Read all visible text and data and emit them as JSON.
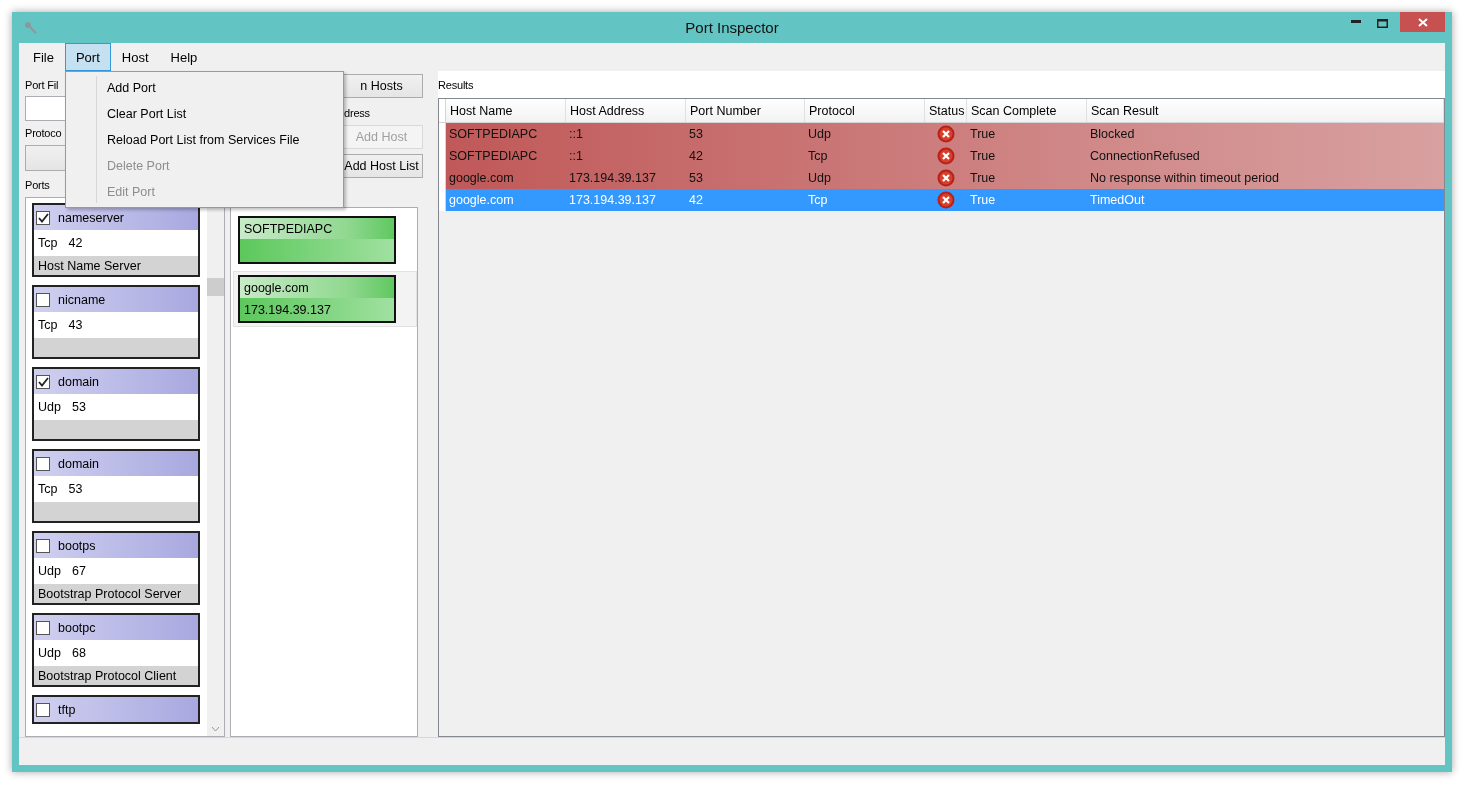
{
  "window": {
    "title": "Port Inspector"
  },
  "menu_bar": [
    {
      "label": "File",
      "selected": false
    },
    {
      "label": "Port",
      "selected": true
    },
    {
      "label": "Host",
      "selected": false
    },
    {
      "label": "Help",
      "selected": false
    }
  ],
  "port_menu": [
    {
      "label": "Add Port",
      "disabled": false
    },
    {
      "label": "Clear Port List",
      "disabled": false
    },
    {
      "label": "Reload Port List from Services File",
      "disabled": false
    },
    {
      "label": "Delete Port",
      "disabled": true
    },
    {
      "label": "Edit Port",
      "disabled": true
    }
  ],
  "left_panel": {
    "port_filter_label": "Port Fil",
    "protocol_label": "Protoco",
    "ports_label": "Ports"
  },
  "ports": [
    {
      "name": "nameserver",
      "checked": true,
      "protocol": "Tcp",
      "number": "42",
      "description": "Host Name Server"
    },
    {
      "name": "nicname",
      "checked": false,
      "protocol": "Tcp",
      "number": "43"
    },
    {
      "name": "domain",
      "checked": true,
      "protocol": "Udp",
      "number": "53"
    },
    {
      "name": "domain",
      "checked": false,
      "protocol": "Tcp",
      "number": "53"
    },
    {
      "name": "bootps",
      "checked": false,
      "protocol": "Udp",
      "number": "67",
      "description": "Bootstrap Protocol Server"
    },
    {
      "name": "bootpc",
      "checked": false,
      "protocol": "Udp",
      "number": "68",
      "description": "Bootstrap Protocol Client"
    },
    {
      "name": "tftp",
      "checked": false
    }
  ],
  "host_panel": {
    "scan_button": "n Hosts",
    "address_label": "dress",
    "add_host_button": "Add Host",
    "add_host_disabled": true,
    "add_host_list_button": "Add Host List"
  },
  "hosts": [
    {
      "name": "SOFTPEDIAPC",
      "selected": false
    },
    {
      "name": "google.com",
      "address": "173.194.39.137",
      "selected": true
    }
  ],
  "results": {
    "label": "Results",
    "columns": [
      "Host Name",
      "Host Address",
      "Port Number",
      "Protocol",
      "Status",
      "Scan Complete",
      "Scan Result"
    ],
    "rows": [
      {
        "host_name": "SOFTPEDIAPC",
        "host_address": "::1",
        "port_number": "53",
        "protocol": "Udp",
        "failed": true,
        "scan_complete": "True",
        "scan_result": "Blocked",
        "selected": false
      },
      {
        "host_name": "SOFTPEDIAPC",
        "host_address": "::1",
        "port_number": "42",
        "protocol": "Tcp",
        "failed": true,
        "scan_complete": "True",
        "scan_result": "ConnectionRefused",
        "selected": false
      },
      {
        "host_name": "google.com",
        "host_address": "173.194.39.137",
        "port_number": "53",
        "protocol": "Udp",
        "failed": true,
        "scan_complete": "True",
        "scan_result": "No response within timeout period",
        "selected": false
      },
      {
        "host_name": "google.com",
        "host_address": "173.194.39.137",
        "port_number": "42",
        "protocol": "Tcp",
        "failed": true,
        "scan_complete": "True",
        "scan_result": "TimedOut",
        "selected": true
      }
    ]
  }
}
